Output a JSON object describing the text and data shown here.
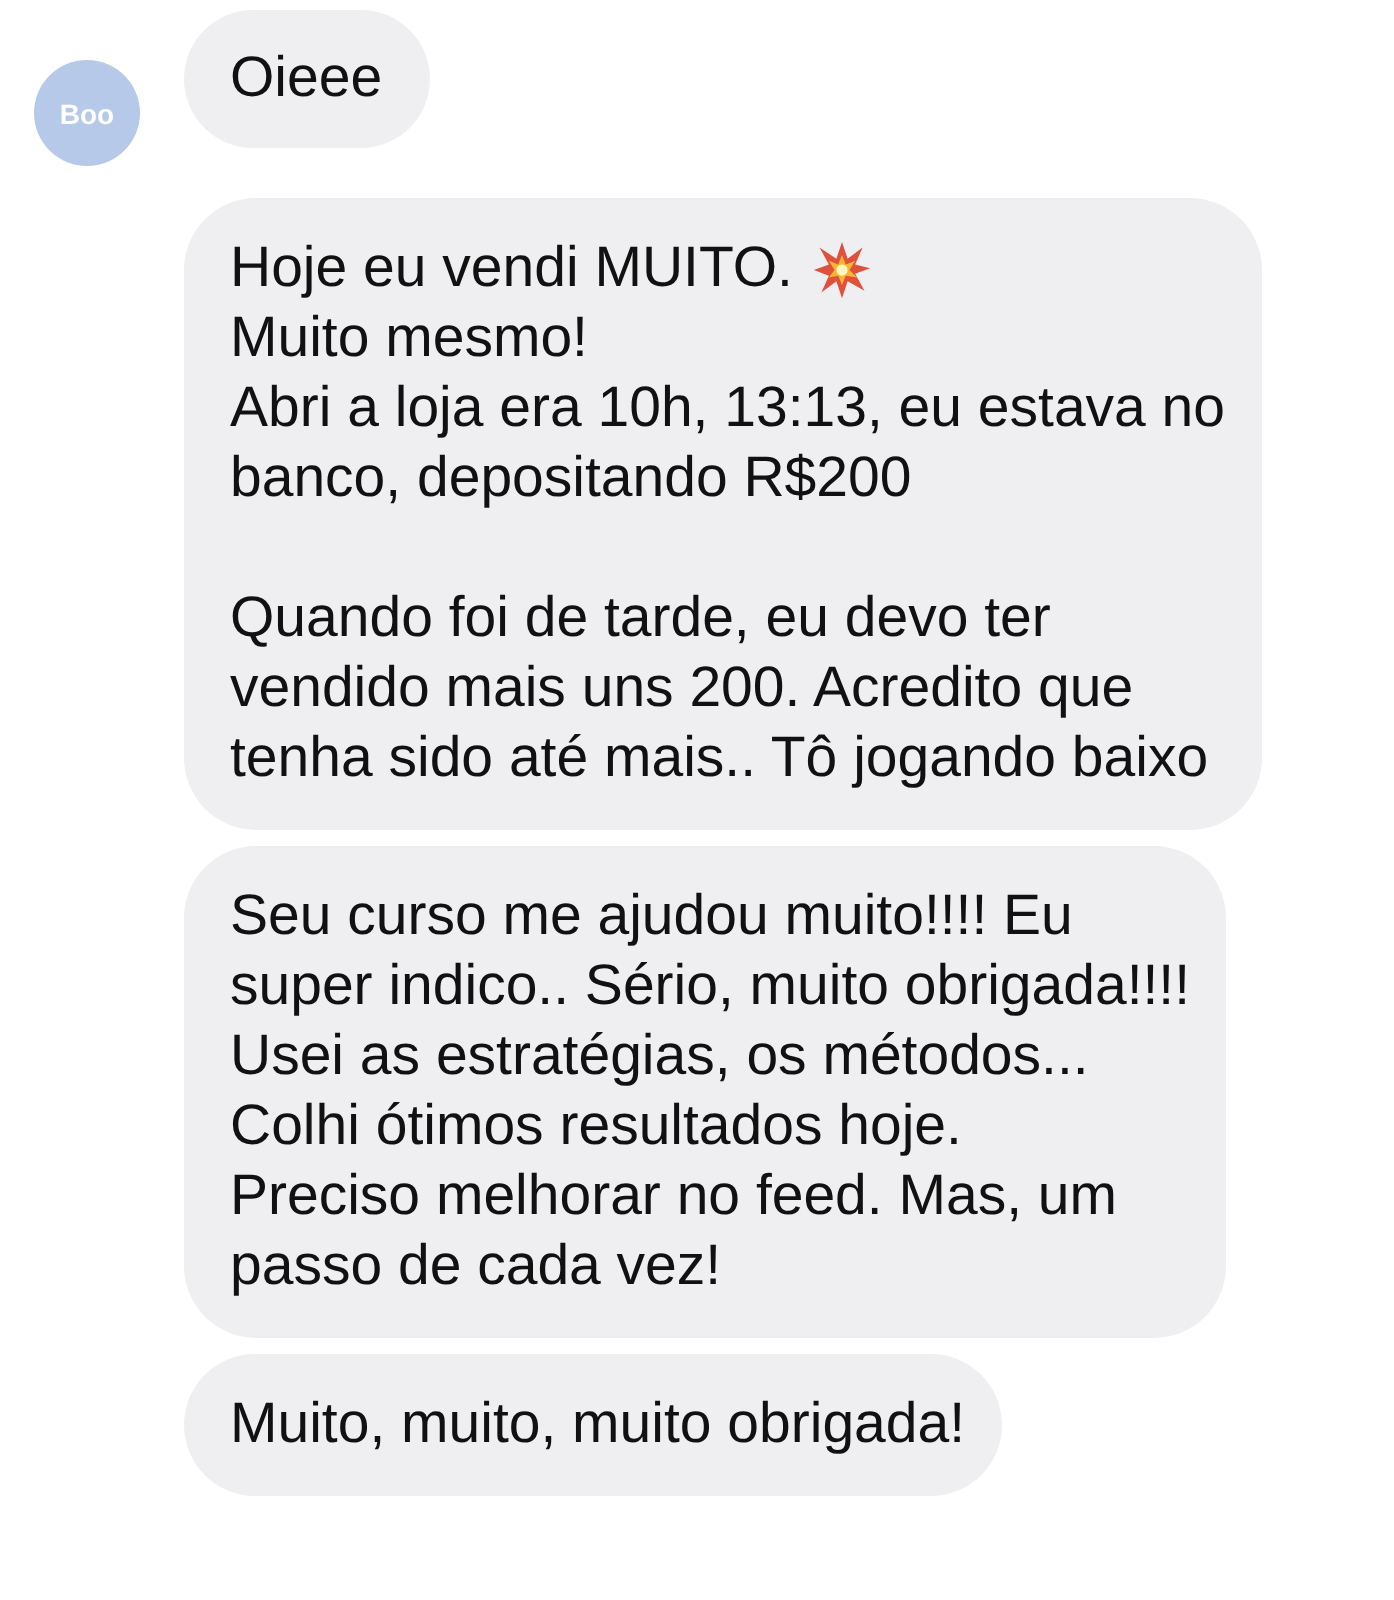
{
  "avatar": {
    "text": "Boo"
  },
  "messages": [
    {
      "paragraphs": [
        [
          {
            "text": "Oieee"
          }
        ]
      ]
    },
    {
      "paragraphs": [
        [
          {
            "text": "Hoje eu vendi MUITO.",
            "burst": true
          },
          {
            "text": "Muito mesmo!"
          },
          {
            "text": "Abri a loja era 10h, 13:13, eu estava no"
          },
          {
            "text": "banco, depositando R$200"
          }
        ],
        [
          {
            "text": "Quando foi de tarde, eu devo ter"
          },
          {
            "text": "vendido mais uns 200. Acredito que"
          },
          {
            "text": "tenha sido até mais.. Tô jogando baixo"
          }
        ]
      ]
    },
    {
      "paragraphs": [
        [
          {
            "text": "Seu curso me ajudou muito!!!! Eu"
          },
          {
            "text": "super indico.. Sério, muito obrigada!!!!"
          },
          {
            "text": "Usei as estratégias, os métodos..."
          },
          {
            "text": "Colhi ótimos resultados hoje."
          },
          {
            "text": "Preciso melhorar no feed. Mas, um"
          },
          {
            "text": "passo de cada vez!"
          }
        ]
      ]
    },
    {
      "paragraphs": [
        [
          {
            "text": "Muito, muito, muito obrigada!"
          }
        ]
      ]
    }
  ]
}
